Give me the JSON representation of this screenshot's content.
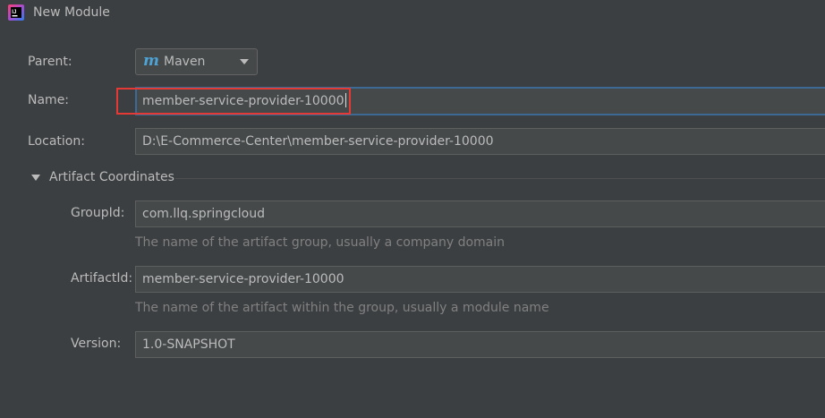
{
  "window": {
    "title": "New Module",
    "app_icon": "intellij-idea-icon"
  },
  "form": {
    "parent": {
      "label": "Parent:",
      "value": "Maven",
      "icon": "maven-icon"
    },
    "name": {
      "label": "Name:",
      "value": "member-service-provider-10000"
    },
    "location": {
      "label": "Location:",
      "value": "D:\\E-Commerce-Center\\member-service-provider-10000"
    }
  },
  "artifact": {
    "section_title": "Artifact Coordinates",
    "groupid": {
      "label": "GroupId:",
      "value": "com.llq.springcloud",
      "hint": "The name of the artifact group, usually a company domain"
    },
    "artifactid": {
      "label": "ArtifactId:",
      "value": "member-service-provider-10000",
      "hint": "The name of the artifact within the group, usually a module name"
    },
    "version": {
      "label": "Version:",
      "value": "1.0-SNAPSHOT"
    }
  },
  "colors": {
    "background": "#3c3f41",
    "field_background": "#45494a",
    "focus_border": "#3c6a94",
    "highlight": "#e53935",
    "maven_accent": "#4ea3d6"
  }
}
